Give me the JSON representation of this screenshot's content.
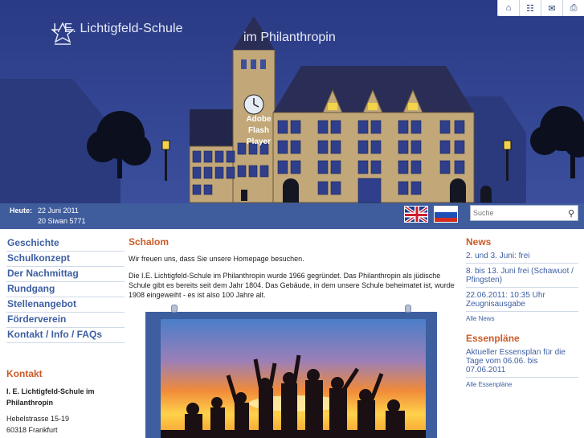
{
  "header": {
    "logo_text": "I. E. Lichtigfeld-Schule",
    "logo_sub": "im Philanthropin",
    "flash_label": "Adobe Flash Player"
  },
  "top_icons": [
    "home-icon",
    "sitemap-icon",
    "mail-icon",
    "print-icon"
  ],
  "datebar": {
    "label": "Heute:",
    "date_gregorian": "22 Juni 2011",
    "date_hebrew": "20 Siwan 5771",
    "search_placeholder": "Suche"
  },
  "nav": {
    "items": [
      {
        "label": "Geschichte"
      },
      {
        "label": "Schulkonzept"
      },
      {
        "label": "Der Nachmittag"
      },
      {
        "label": "Rundgang"
      },
      {
        "label": "Stellenangebot"
      },
      {
        "label": "Förderverein"
      },
      {
        "label": "Kontakt / Info / FAQs"
      }
    ]
  },
  "contact": {
    "heading": "Kontakt",
    "name": "I. E. Lichtigfeld-Schule im Philanthropin",
    "street": "Hebelstrasse 15-19",
    "city": "60318 Frankfurt"
  },
  "main": {
    "heading": "Schalom",
    "p1": "Wir freuen uns, dass Sie unsere Homepage besuchen.",
    "p2": "Die I.E. Lichtigfeld-Schule im Philanthropin wurde 1966 gegründet. Das Philanthropin als jüdische Schule gibt es bereits seit dem Jahr 1804. Das Gebäude, in dem unsere Schule beheimatet ist, wurde 1908 eingeweiht - es ist also 100 Jahre alt."
  },
  "news": {
    "heading": "News",
    "items": [
      {
        "label": "2. und 3. Juni: frei"
      },
      {
        "label": "8. bis 13. Juni frei (Schawuot / Pfingsten)"
      },
      {
        "label": "22.06.2011: 10:35 Uhr Zeugnisausgabe"
      }
    ],
    "more": "Alle News"
  },
  "essen": {
    "heading": "Essenpläne",
    "items": [
      {
        "label": "Aktueller Essensplan für die Tage vom 06.06. bis 07.06.2011"
      }
    ],
    "more": "Alle Essenpläne"
  },
  "colors": {
    "accent": "#cc5a28",
    "link": "#3d5fa2",
    "bar": "#3f5d9d",
    "sky": "#324491"
  }
}
